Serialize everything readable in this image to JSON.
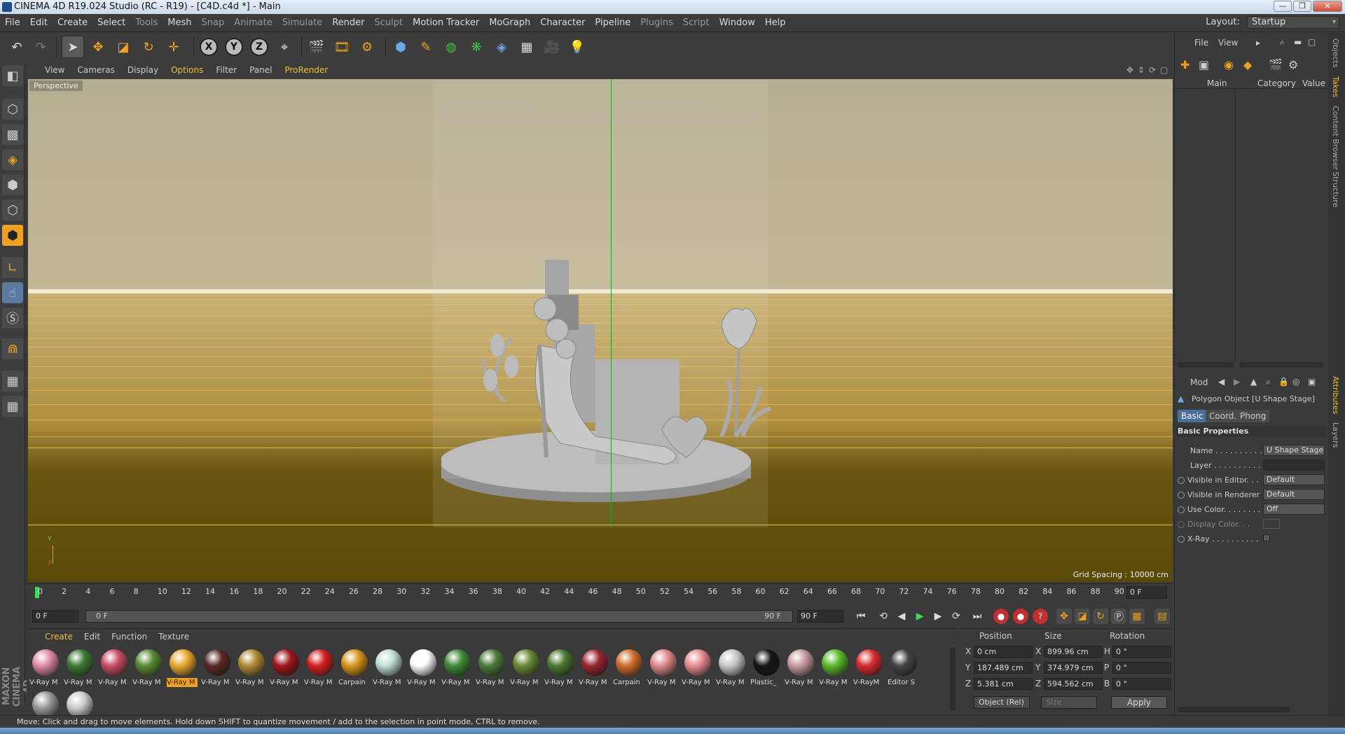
{
  "window": {
    "title": "CINEMA 4D R19.024 Studio (RC - R19) - [C4D.c4d *] - Main",
    "controls": [
      "—",
      "❐",
      "✕"
    ]
  },
  "menubar": {
    "items": [
      "File",
      "Edit",
      "Create",
      "Select",
      "Tools",
      "Mesh",
      "Snap",
      "Animate",
      "Simulate",
      "Render",
      "Sculpt",
      "Motion Tracker",
      "MoGraph",
      "Character",
      "Pipeline",
      "Plugins",
      "Script",
      "Window",
      "Help"
    ],
    "layout_label": "Layout:",
    "layout_value": "Startup"
  },
  "viewport": {
    "menu": [
      "View",
      "Cameras",
      "Display",
      "Options",
      "Filter",
      "Panel",
      "ProRender"
    ],
    "camera_label": "Perspective",
    "grid_spacing": "Grid Spacing : 10000 cm",
    "axis_y": "Y",
    "axis_x": "X"
  },
  "timeline": {
    "ticks": [
      "0",
      "2",
      "4",
      "6",
      "8",
      "10",
      "12",
      "14",
      "16",
      "18",
      "20",
      "22",
      "24",
      "26",
      "28",
      "30",
      "32",
      "34",
      "36",
      "38",
      "40",
      "42",
      "44",
      "46",
      "48",
      "50",
      "52",
      "54",
      "56",
      "58",
      "60",
      "62",
      "64",
      "66",
      "68",
      "70",
      "72",
      "74",
      "76",
      "78",
      "80",
      "82",
      "84",
      "86",
      "88",
      "90"
    ],
    "current_frame": "0 F",
    "start_frame": "0 F",
    "range_start": "0 F",
    "range_end": "90 F",
    "end_frame": "90 F"
  },
  "materials": {
    "menu": [
      "Create",
      "Edit",
      "Function",
      "Texture"
    ],
    "items": [
      {
        "label": "V-Ray M",
        "color": "#e08aa6"
      },
      {
        "label": "V-Ray M",
        "color": "#3f7a32"
      },
      {
        "label": "V-Ray M",
        "color": "#c84e64"
      },
      {
        "label": "V-Ray M",
        "color": "#5a8a35"
      },
      {
        "label": "V-Ray M",
        "color": "#e8a830",
        "selected": true
      },
      {
        "label": "V-Ray M",
        "color": "#5a2a25"
      },
      {
        "label": "V-Ray M",
        "color": "#b08a35"
      },
      {
        "label": "V-Ray M",
        "color": "#a0151e"
      },
      {
        "label": "V-Ray M",
        "color": "#d42020"
      },
      {
        "label": "Carpain",
        "color": "#d8951a"
      },
      {
        "label": "V-Ray M",
        "color": "#c0dcd6"
      },
      {
        "label": "V-Ray M",
        "color": "#ffffff"
      },
      {
        "label": "V-Ray M",
        "color": "#3f8a35"
      },
      {
        "label": "V-Ray M",
        "color": "#4e7a3a"
      },
      {
        "label": "V-Ray M",
        "color": "#6a8a35"
      },
      {
        "label": "V-Ray M",
        "color": "#4a7a30"
      },
      {
        "label": "V-Ray M",
        "color": "#9a2530"
      },
      {
        "label": "Carpain",
        "color": "#d06a2a"
      },
      {
        "label": "V-Ray M",
        "color": "#e08a8a"
      },
      {
        "label": "V-Ray M",
        "color": "#e88a90"
      },
      {
        "label": "V-Ray M",
        "color": "#c8c8c8"
      },
      {
        "label": "Plastic_",
        "color": "#151515"
      },
      {
        "label": "V-Ray M",
        "color": "#c89aa0"
      },
      {
        "label": "V-Ray M",
        "color": "#5ab82a"
      },
      {
        "label": "V-RayM",
        "color": "#d82a30"
      },
      {
        "label": "Editor S",
        "color": "#444444"
      },
      {
        "label": "",
        "color": "#9a9a9a"
      },
      {
        "label": "",
        "color": "#cccccc"
      }
    ]
  },
  "coords": {
    "headers": [
      "Position",
      "Size",
      "Rotation"
    ],
    "rows": [
      {
        "axis": "X",
        "pos": "0 cm",
        "saxis": "X",
        "size": "899.96 cm",
        "raxis": "H",
        "rot": "0 °"
      },
      {
        "axis": "Y",
        "pos": "187.489 cm",
        "saxis": "Y",
        "size": "374.979 cm",
        "raxis": "P",
        "rot": "0 °"
      },
      {
        "axis": "Z",
        "pos": "5.381 cm",
        "saxis": "Z",
        "size": "594.562 cm",
        "raxis": "B",
        "rot": "0 °"
      }
    ],
    "mode_dropdown": "Object (Rel)",
    "size_dropdown": "Size",
    "apply_label": "Apply"
  },
  "object_manager": {
    "menu": [
      "File",
      "View"
    ],
    "columns": [
      "Main",
      "Category",
      "Value"
    ]
  },
  "attributes": {
    "mode_label": "Mod",
    "object_title": "Polygon Object [U Shape Stage]",
    "tabs": [
      "Basic",
      "Coord.",
      "Phong"
    ],
    "section": "Basic Properties",
    "rows": [
      {
        "label": "Name . . . . . . . . . . .",
        "value": "U Shape Stage"
      },
      {
        "label": "Layer . . . . . . . . . . .",
        "value": ""
      },
      {
        "label": "Visible in Editor. . .",
        "value": "Default"
      },
      {
        "label": "Visible in Renderer",
        "value": "Default"
      },
      {
        "label": "Use Color. . . . . . . .",
        "value": "Off"
      },
      {
        "label": "Display Color. . .",
        "value": ""
      },
      {
        "label": "X-Ray . . . . . . . . . .",
        "value": ""
      }
    ]
  },
  "side_tabs": [
    "Objects",
    "Takes",
    "Content Browser",
    "Structure",
    "Attributes",
    "Layers"
  ],
  "status": "Move: Click and drag to move elements. Hold down SHIFT to quantize movement / add to the selection in point mode, CTRL to remove.",
  "brand": "MAXON CINEMA 4D"
}
